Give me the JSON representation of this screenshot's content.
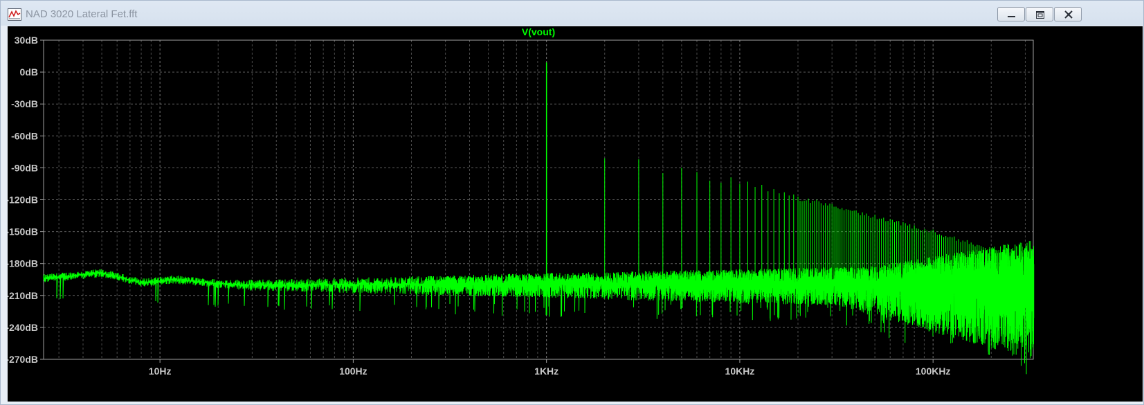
{
  "window": {
    "title": "NAD 3020 Lateral Fet.fft",
    "controls": [
      "minimize",
      "restore",
      "close"
    ],
    "icons": [
      "waveform-app-icon",
      "minimize-icon",
      "restore-icon",
      "close-icon"
    ]
  },
  "chart_data": {
    "type": "line",
    "title": "V(vout)",
    "xlabel": "",
    "ylabel": "",
    "x_scale": "log",
    "xlim": [
      2.5,
      330000
    ],
    "ylim": [
      -270,
      30
    ],
    "x_ticks": [
      {
        "value": 10,
        "label": "10Hz"
      },
      {
        "value": 100,
        "label": "100Hz"
      },
      {
        "value": 1000,
        "label": "1KHz"
      },
      {
        "value": 10000,
        "label": "10KHz"
      },
      {
        "value": 100000,
        "label": "100KHz"
      }
    ],
    "y_ticks": [
      {
        "value": 30,
        "label": "30dB"
      },
      {
        "value": 0,
        "label": "0dB"
      },
      {
        "value": -30,
        "label": "-30dB"
      },
      {
        "value": -60,
        "label": "-60dB"
      },
      {
        "value": -90,
        "label": "-90dB"
      },
      {
        "value": -120,
        "label": "-120dB"
      },
      {
        "value": -150,
        "label": "-150dB"
      },
      {
        "value": -180,
        "label": "-180dB"
      },
      {
        "value": -210,
        "label": "-210dB"
      },
      {
        "value": -240,
        "label": "-240dB"
      },
      {
        "value": -270,
        "label": "-270dB"
      }
    ],
    "grid": true,
    "colors": {
      "trace": "#00ff00",
      "background": "#000000",
      "grid": "#8a8a8a",
      "axis_text": "#c8c8c8",
      "title": "#00ff00"
    },
    "series": [
      {
        "name": "V(vout)",
        "noise_floor": [
          [
            2.5,
            -194
          ],
          [
            5,
            -189
          ],
          [
            8,
            -198
          ],
          [
            12,
            -195
          ],
          [
            20,
            -199
          ],
          [
            30,
            -200
          ],
          [
            100,
            -200
          ],
          [
            1000,
            -199
          ],
          [
            10000,
            -199
          ],
          [
            100000,
            -198
          ],
          [
            330000,
            -198
          ]
        ],
        "fundamental": {
          "x": 1000,
          "y": 9
        },
        "harmonics": [
          {
            "x": 2000,
            "y": -81
          },
          {
            "x": 3000,
            "y": -82
          },
          {
            "x": 4000,
            "y": -95
          },
          {
            "x": 5000,
            "y": -90
          },
          {
            "x": 6000,
            "y": -94
          },
          {
            "x": 7000,
            "y": -102
          },
          {
            "x": 8000,
            "y": -104
          },
          {
            "x": 9000,
            "y": -99
          },
          {
            "x": 10000,
            "y": -105
          },
          {
            "x": 11000,
            "y": -103
          },
          {
            "x": 12000,
            "y": -108
          },
          {
            "x": 13000,
            "y": -106
          },
          {
            "x": 14000,
            "y": -112
          },
          {
            "x": 15000,
            "y": -110
          },
          {
            "x": 16000,
            "y": -114
          },
          {
            "x": 17000,
            "y": -113
          },
          {
            "x": 18000,
            "y": -116
          },
          {
            "x": 19000,
            "y": -115
          },
          {
            "x": 20000,
            "y": -117
          },
          {
            "x": 25000,
            "y": -120
          },
          {
            "x": 30000,
            "y": -124
          },
          {
            "x": 40000,
            "y": -130
          },
          {
            "x": 50000,
            "y": -134
          },
          {
            "x": 60000,
            "y": -138
          },
          {
            "x": 70000,
            "y": -141
          },
          {
            "x": 80000,
            "y": -144
          },
          {
            "x": 100000,
            "y": -148
          },
          {
            "x": 150000,
            "y": -158
          },
          {
            "x": 200000,
            "y": -166
          },
          {
            "x": 250000,
            "y": -174
          },
          {
            "x": 330000,
            "y": -181
          }
        ]
      }
    ]
  }
}
